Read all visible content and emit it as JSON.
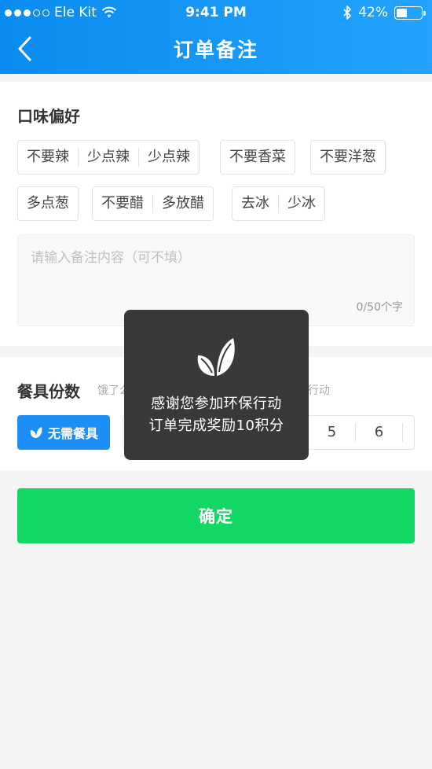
{
  "status_bar": {
    "carrier": "Ele Kit",
    "time": "9:41 PM",
    "battery": "42%",
    "battery_level": 0.42
  },
  "nav": {
    "title": "订单备注"
  },
  "taste": {
    "title": "口味偏好",
    "groups": [
      [
        "不要辣",
        "少点辣",
        "少点辣"
      ],
      [
        "不要香菜"
      ],
      [
        "不要洋葱"
      ],
      [
        "多点葱"
      ],
      [
        "不要醋",
        "多放醋"
      ],
      [
        "去冰",
        "少冰"
      ]
    ],
    "remark_placeholder": "请输入备注内容（可不填）",
    "remark_count": "0/50个字"
  },
  "tableware": {
    "title": "餐具份数",
    "hint_left": "饿了么",
    "hint_right": "行动",
    "no_tableware_label": "无需餐具",
    "quantities": [
      "5",
      "6"
    ]
  },
  "confirm_label": "确定",
  "toast": {
    "line1": "感谢您参加环保行动",
    "line2": "订单完成奖励10积分"
  },
  "colors": {
    "header": "#0a8cf0",
    "primary": "#1b8ff6",
    "confirm": "#11d763"
  }
}
